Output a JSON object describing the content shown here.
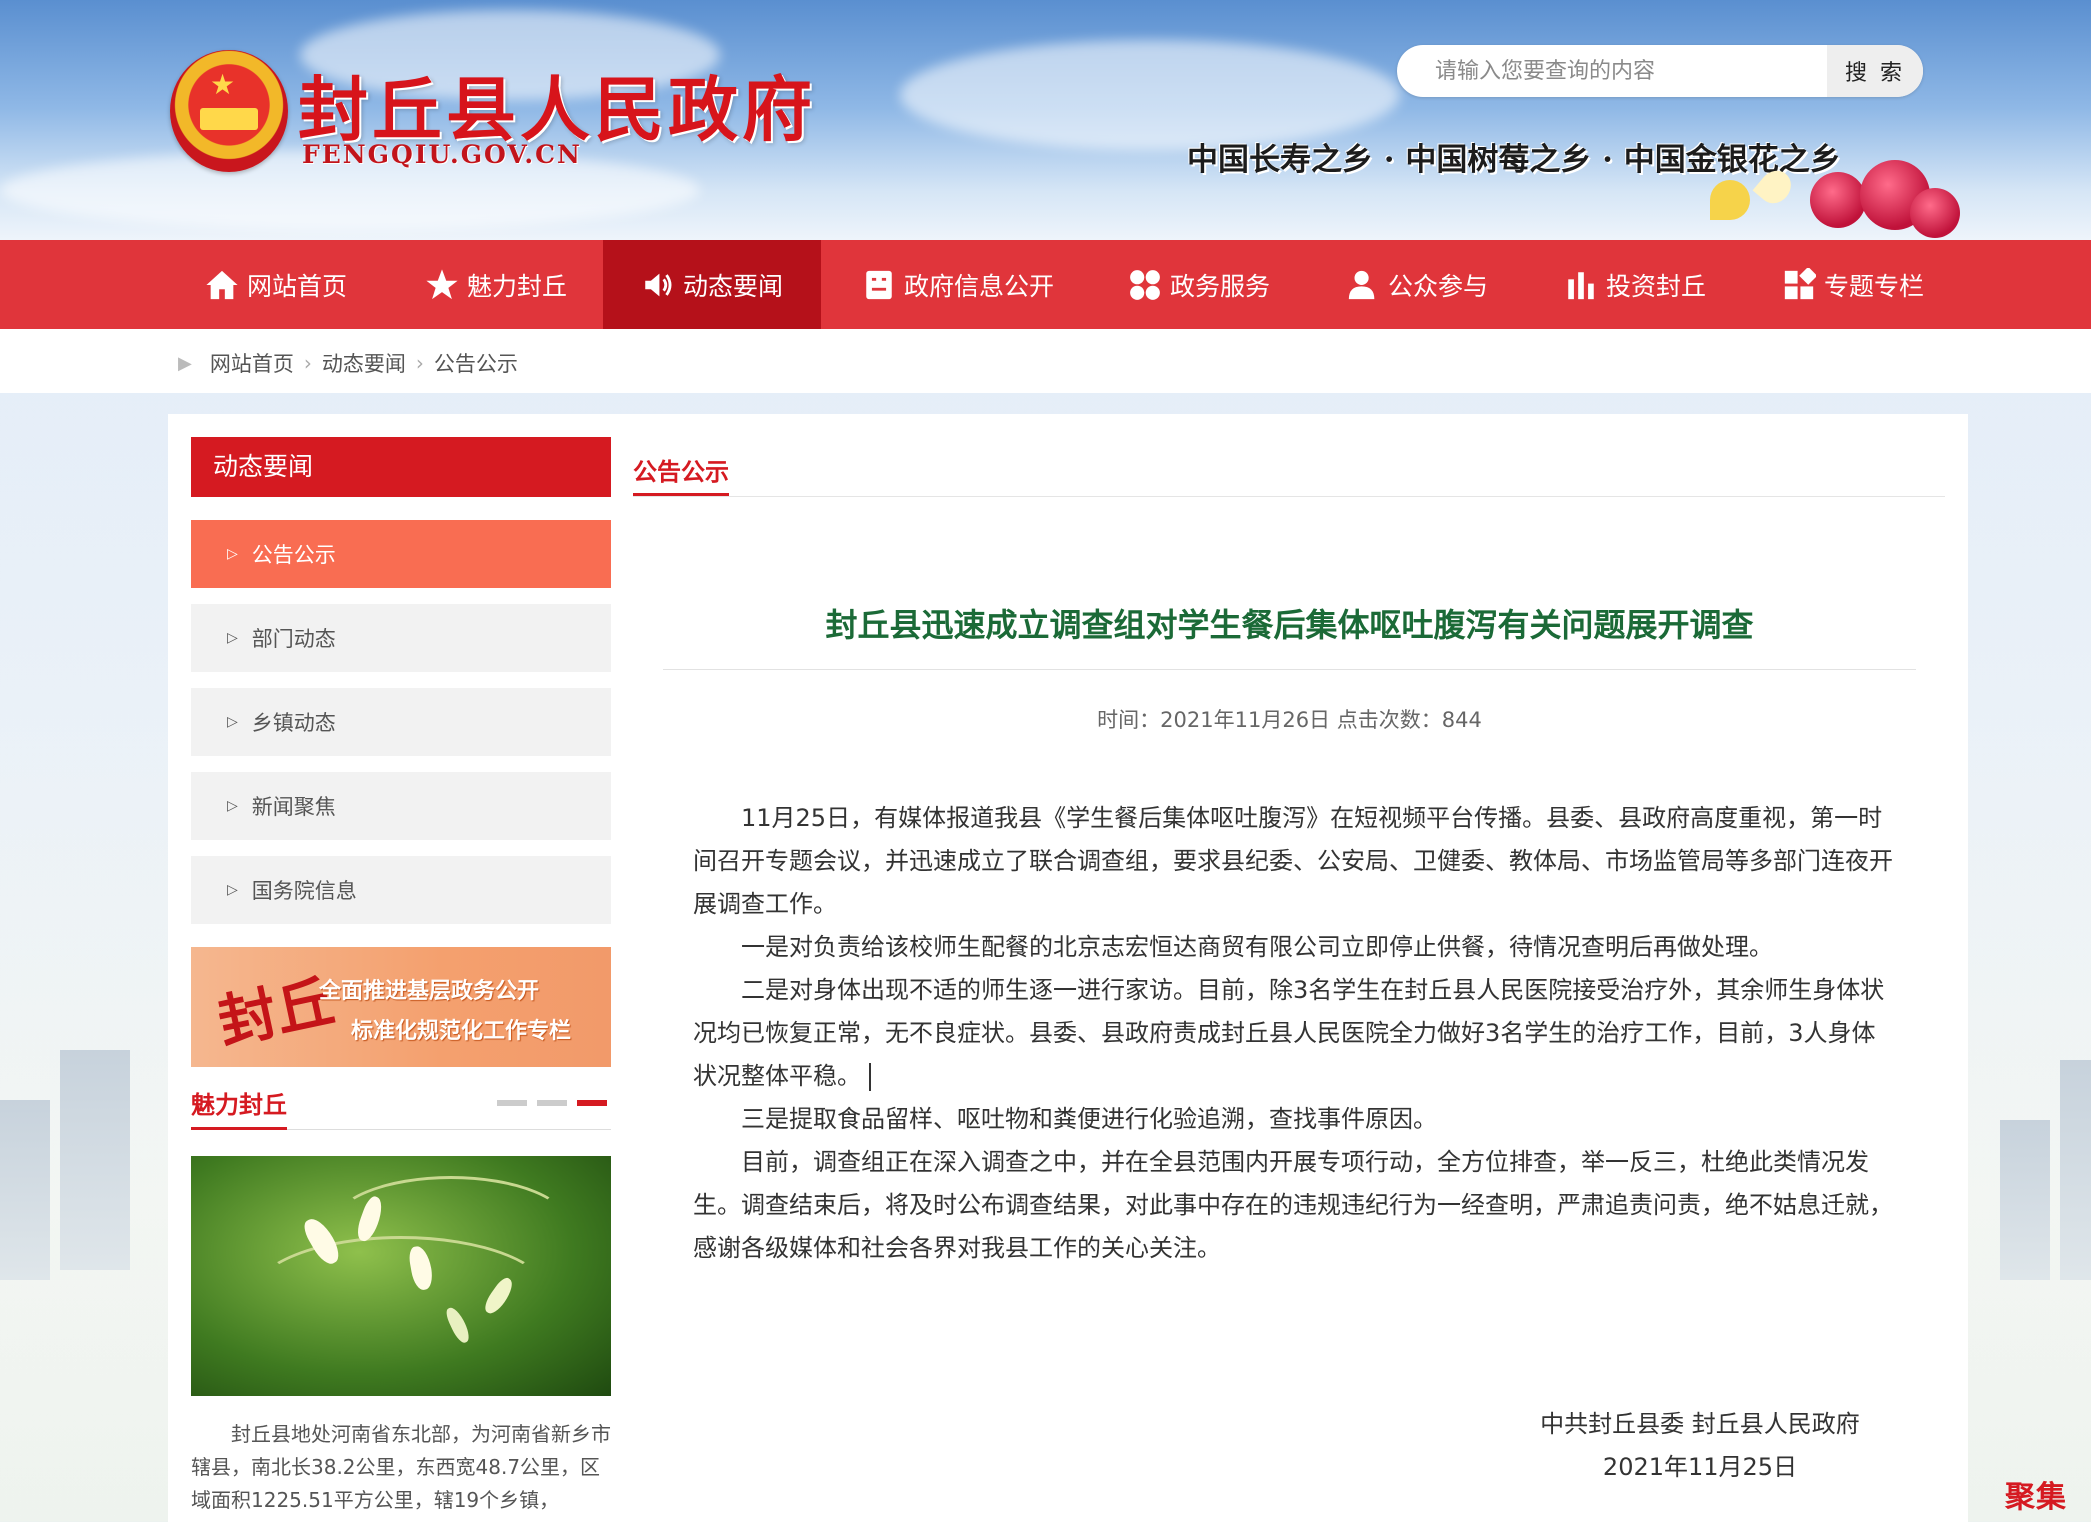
{
  "header": {
    "site_title": "封丘县人民政府",
    "site_domain": "FENGQIU.GOV.CN",
    "search_placeholder": "请输入您要查询的内容",
    "search_button": "搜 索",
    "slogan": "中国长寿之乡 · 中国树莓之乡 · 中国金银花之乡"
  },
  "nav": {
    "items": [
      {
        "label": "网站首页",
        "icon": "home-icon"
      },
      {
        "label": "魅力封丘",
        "icon": "star-icon"
      },
      {
        "label": "动态要闻",
        "icon": "speaker-icon",
        "active": true
      },
      {
        "label": "政府信息公开",
        "icon": "document-icon"
      },
      {
        "label": "政务服务",
        "icon": "grid-icon"
      },
      {
        "label": "公众参与",
        "icon": "user-icon"
      },
      {
        "label": "投资封丘",
        "icon": "bar-chart-icon"
      },
      {
        "label": "专题专栏",
        "icon": "tiles-icon"
      }
    ],
    "active_color": "#b5111a",
    "bar_color": "#e0353b"
  },
  "breadcrumb": [
    "网站首页",
    "动态要闻",
    "公告公示"
  ],
  "sidebar": {
    "heading": "动态要闻",
    "items": [
      {
        "label": "公告公示",
        "active": true
      },
      {
        "label": "部门动态"
      },
      {
        "label": "乡镇动态"
      },
      {
        "label": "新闻聚焦"
      },
      {
        "label": "国务院信息"
      }
    ],
    "banner": {
      "big_text": "封丘",
      "line1": "全面推进基层政务公开",
      "line2": "标准化规范化工作专栏"
    },
    "charm": {
      "title": "魅力封丘",
      "intro": "封丘县地处河南省东北部，为河南省新乡市辖县，南北长38.2公里，东西宽48.7公里，区域面积1225.51平方公里，辖19个乡镇，"
    }
  },
  "main": {
    "tab_title": "公告公示",
    "article": {
      "title": "封丘县迅速成立调查组对学生餐后集体呕吐腹泻有关问题展开调查",
      "meta": "时间：2021年11月26日 点击次数：844",
      "paragraphs": [
        "11月25日，有媒体报道我县《学生餐后集体呕吐腹泻》在短视频平台传播。县委、县政府高度重视，第一时间召开专题会议，并迅速成立了联合调查组，要求县纪委、公安局、卫健委、教体局、市场监管局等多部门连夜开展调查工作。",
        "一是对负责给该校师生配餐的北京志宏恒达商贸有限公司立即停止供餐，待情况查明后再做处理。",
        "二是对身体出现不适的师生逐一进行家访。目前，除3名学生在封丘县人民医院接受治疗外，其余师生身体状况均已恢复正常，无不良症状。县委、县政府责成封丘县人民医院全力做好3名学生的治疗工作，目前，3人身体状况整体平稳。",
        "三是提取食品留样、呕吐物和粪便进行化验追溯，查找事件原因。",
        "目前，调查组正在深入调查之中，并在全县范围内开展专项行动，全方位排查，举一反三，杜绝此类情况发生。调查结束后，将及时公布调查结果，对此事中存在的违规违纪行为一经查明，严肃追责问责，绝不姑息迁就，感谢各级媒体和社会各界对我县工作的关心关注。"
      ],
      "signature_org": "中共封丘县委 封丘县人民政府",
      "signature_date": "2021年11月25日"
    }
  },
  "watermark": "聚集号"
}
